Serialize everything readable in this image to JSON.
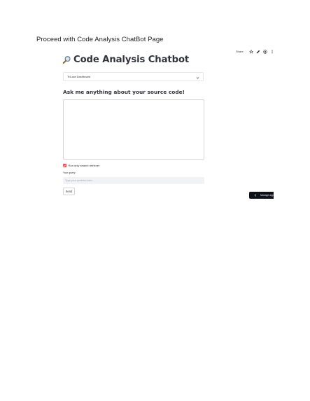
{
  "document": {
    "heading": "Proceed with Code Analysis ChatBot Page"
  },
  "toolbar": {
    "share_label": "Share",
    "icons": [
      "star-icon",
      "edit-icon",
      "github-icon",
      "more-vert-icon"
    ]
  },
  "app": {
    "title": "Code Analysis Chatbot",
    "title_icon": "magnifier-icon",
    "repo_select": {
      "selected": "TriLora Dashboard"
    },
    "subheading": "Ask me anything about your source code!",
    "checkbox": {
      "label": "Run only search retriever",
      "checked": true
    },
    "query": {
      "label": "Your query:",
      "placeholder": "Type your question here...",
      "value": ""
    },
    "send_label": "Send"
  },
  "manage_app": {
    "label": "Manage app"
  },
  "colors": {
    "accent": "#ff4b4b",
    "text": "#31333f",
    "input_bg": "#f0f2f6",
    "manage_bg": "#0e1117"
  }
}
